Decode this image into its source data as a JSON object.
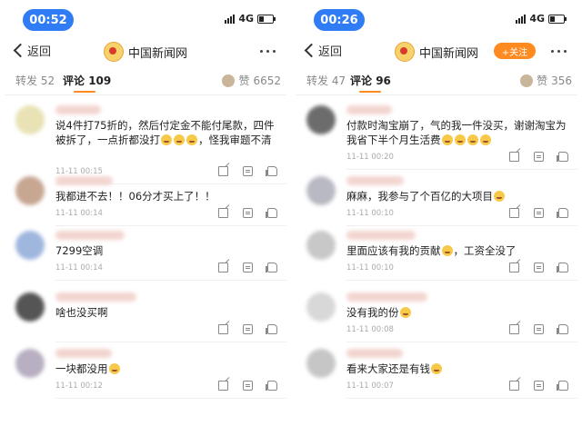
{
  "left": {
    "time": "00:52",
    "network": "4G",
    "back_label": "返回",
    "account_name": "中国新闻网",
    "tab_repost_label": "转发",
    "tab_repost_count": "52",
    "tab_comment_label": "评论",
    "tab_comment_count": "109",
    "likes_label": "赞",
    "likes_count": "6652",
    "comments": [
      {
        "text": "说4件打75折的，然后付定金不能付尾款，四件被拆了，一点折都没打",
        "tail": "，怪我审题不清",
        "emoji_count": 3,
        "time": "11-11 00:15"
      },
      {
        "text": "我都进不去！！06分才买上了！！",
        "tail": "",
        "emoji_count": 0,
        "time": "11-11 00:14"
      },
      {
        "text": "7299空调",
        "tail": "",
        "emoji_count": 0,
        "time": "11-11 00:14"
      },
      {
        "text": "啥也没买啊",
        "tail": "",
        "emoji_count": 0,
        "time": ""
      },
      {
        "text": "一块都没用",
        "tail": "",
        "emoji_count": 1,
        "time": "11-11 00:12"
      }
    ]
  },
  "right": {
    "time": "00:26",
    "network": "4G",
    "back_label": "返回",
    "account_name": "中国新闻网",
    "follow_label": "+关注",
    "tab_repost_label": "转发",
    "tab_repost_count": "47",
    "tab_comment_label": "评论",
    "tab_comment_count": "96",
    "likes_label": "赞",
    "likes_count": "356",
    "comments": [
      {
        "text": "付款时淘宝崩了，气的我一件没买，谢谢淘宝为我省下半个月生活费",
        "tail": "",
        "emoji_count": 4,
        "time": "11-11 00:20"
      },
      {
        "text": "麻麻，我参与了个百亿的大项目",
        "tail": "",
        "emoji_count": 1,
        "time": "11-11 00:10"
      },
      {
        "text": "里面应该有我的贡献",
        "tail": "，工资全没了",
        "emoji_count": 1,
        "time": "11-11 00:10"
      },
      {
        "text": "没有我的份",
        "tail": "",
        "emoji_count": 1,
        "time": "11-11 00:08"
      },
      {
        "text": "看来大家还是有钱",
        "tail": "",
        "emoji_count": 1,
        "time": "11-11 00:07"
      }
    ]
  },
  "colors": {
    "accent": "#ff8a1f",
    "time_pill": "#2f7cf5"
  }
}
